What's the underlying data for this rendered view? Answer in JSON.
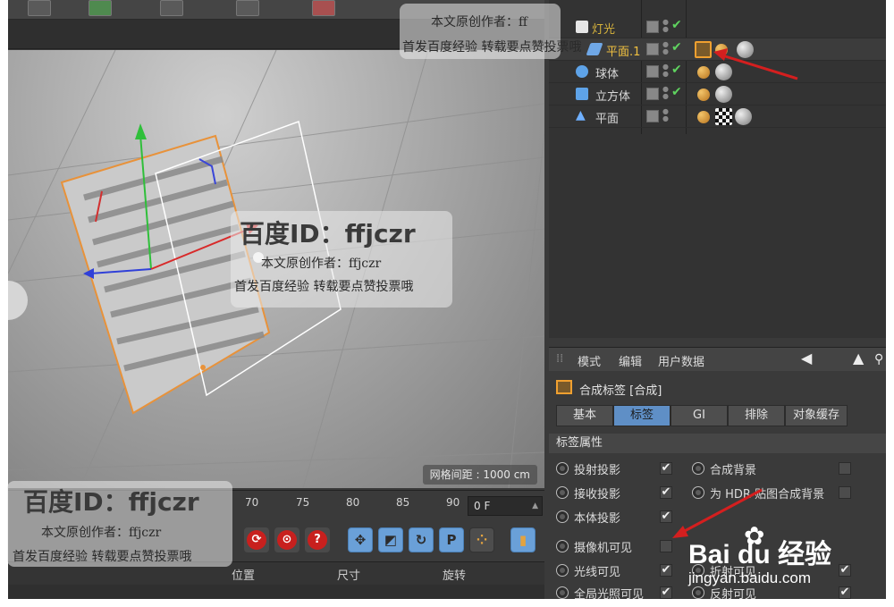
{
  "object_manager": {
    "rows": [
      {
        "name": "灯光",
        "color": "#d8b43c"
      },
      {
        "name": "平面.1",
        "color": "#f0c040"
      },
      {
        "name": "球体",
        "color": "#d8d8d8"
      },
      {
        "name": "立方体",
        "color": "#d8d8d8"
      },
      {
        "name": "平面",
        "color": "#d8d8d8"
      }
    ]
  },
  "viewport": {
    "grid_readout": "网格间距 : 1000 cm"
  },
  "timeline": {
    "ticks": [
      "70",
      "75",
      "80",
      "85",
      "90"
    ],
    "frame": "0 F"
  },
  "transport": {
    "red_buttons": [
      "⟳",
      "⊙",
      "?"
    ],
    "blue_buttons": [
      "✥",
      "◩",
      "↻",
      "P",
      "⁘"
    ]
  },
  "coords": {
    "columns": [
      "位置",
      "尺寸",
      "旋转"
    ]
  },
  "attr_manager": {
    "menu": [
      "模式",
      "编辑",
      "用户数据"
    ],
    "title": "合成标签 [合成]",
    "tabs": [
      "基本",
      "标签",
      "GI",
      "排除",
      "对象缓存"
    ],
    "active_tab": "标签",
    "section": "标签属性",
    "props_left": [
      {
        "label": "投射投影",
        "checked": "✔"
      },
      {
        "label": "接收投影",
        "checked": "✔"
      },
      {
        "label": "本体投影",
        "checked": "✔"
      },
      {
        "label": "摄像机可见",
        "checked": ""
      },
      {
        "label": "光线可见",
        "checked": "✔"
      },
      {
        "label": "全局光照可见",
        "checked": "✔"
      }
    ],
    "props_right": [
      {
        "label": "合成背景",
        "checked": ""
      },
      {
        "label": "为 HDR 贴图合成背景",
        "checked": ""
      },
      {
        "label": "折射可见",
        "checked": "✔"
      },
      {
        "label": "反射可见",
        "checked": "✔"
      }
    ]
  },
  "watermarks": {
    "id_text": "百度ID：ffjczr",
    "author": "本文原创作者：ffjczr",
    "notice": "首发百度经验  转载要点赞投票哦",
    "author_top": "本文原创作者：ff",
    "notice_top": "首发百度经验  转载要点赞投票哦",
    "logo_text": "Bai du 经验",
    "logo_url": "jingyan.baidu.com"
  },
  "accent_colors": {
    "selection_orange": "#e8923a",
    "active_tab_blue": "#5f8fc6",
    "annotation_red": "#d41f1f"
  }
}
